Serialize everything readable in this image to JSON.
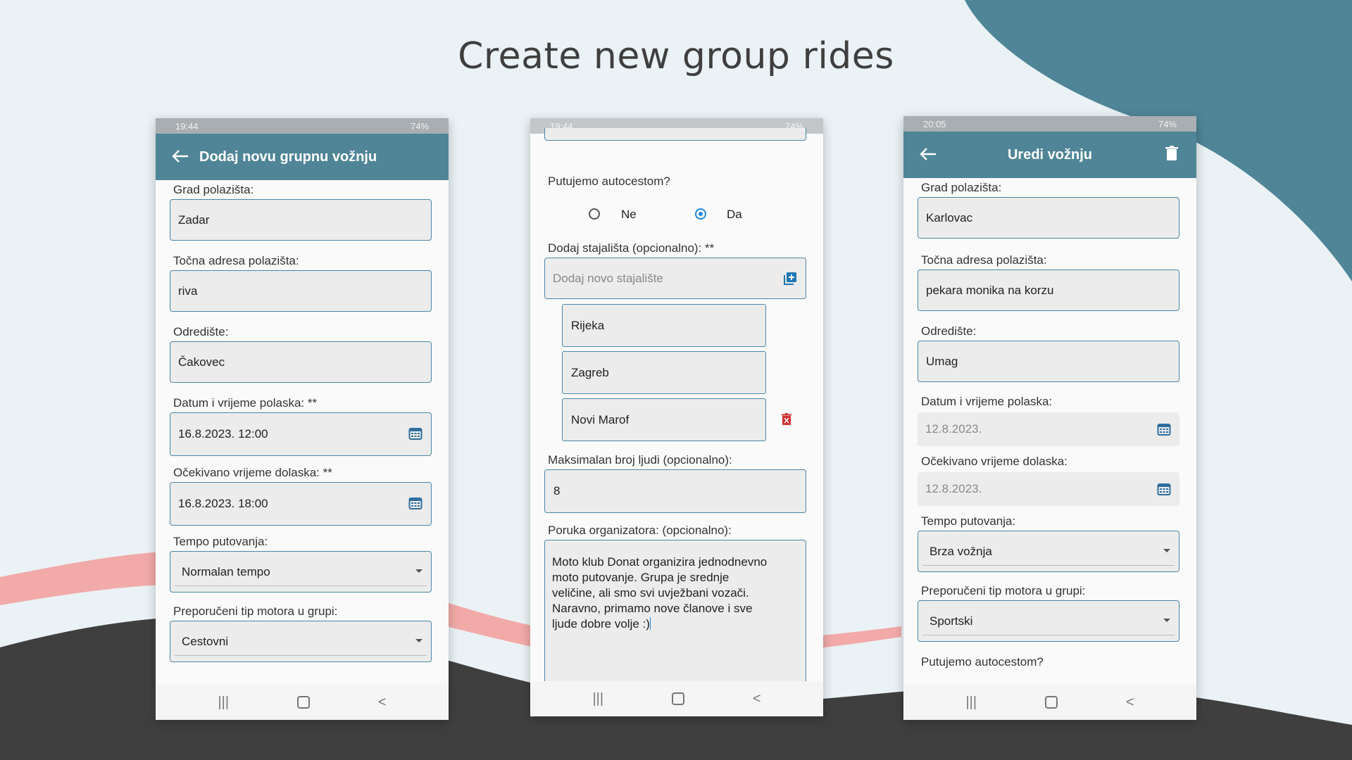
{
  "headline": "Create new group rides",
  "colors": {
    "appbar": "#4f8597",
    "field_border": "#4a86a8",
    "accent_blue": "#1e88e5",
    "delete_red": "#d32f2f",
    "blob_teal": "#4f8597",
    "blob_pink": "#f2aaa8",
    "blob_dark": "#3f3f3f"
  },
  "phone1": {
    "status": {
      "time": "19:44",
      "battery": "74%"
    },
    "appbar_title": "Dodaj novu grupnu vožnju",
    "icons": {
      "back": "arrow-left-icon",
      "calendar": "calendar-icon"
    },
    "fields": {
      "grad_label": "Grad polazišta:",
      "grad_value": "Zadar",
      "adresa_label": "Točna adresa polazišta:",
      "adresa_value": "riva",
      "odrediste_label": "Odredište:",
      "odrediste_value": "Čakovec",
      "datum_label": "Datum i vrijeme polaska: **",
      "datum_value": "16.8.2023. 12:00",
      "dolazak_label": "Očekivano vrijeme dolaska: **",
      "dolazak_value": "16.8.2023. 18:00",
      "tempo_label": "Tempo putovanja:",
      "tempo_value": "Normalan tempo",
      "motor_label": "Preporučeni tip motora u grupi:",
      "motor_value": "Cestovni"
    }
  },
  "phone2": {
    "status": {
      "time": "19:44",
      "battery": "74%"
    },
    "autocesta_label": "Putujemo autocestom?",
    "radio_ne": "Ne",
    "radio_da": "Da",
    "radio_selected": "Da",
    "stajalista_label": "Dodaj stajališta (opcionalno): **",
    "stajalista_placeholder": "Dodaj novo stajalište",
    "stops": [
      "Rijeka",
      "Zagreb",
      "Novi Marof"
    ],
    "max_label": "Maksimalan broj ljudi (opcionalno):",
    "max_value": "8",
    "poruka_label": "Poruka organizatora: (opcionalno):",
    "poruka_lines": [
      "Moto klub Donat organizira jednodnevno",
      "moto putovanje. Grupa je srednje",
      "veličine, ali smo svi uvježbani vozači.",
      "Naravno, primamo nove članove i sve",
      "ljude dobre volje :)"
    ]
  },
  "phone3": {
    "status": {
      "time": "20:05",
      "battery": "74%"
    },
    "appbar_title": "Uredi vožnju",
    "icons": {
      "back": "arrow-left-icon",
      "delete": "trash-icon",
      "calendar": "calendar-icon"
    },
    "fields": {
      "grad_label": "Grad polazišta:",
      "grad_value": "Karlovac",
      "adresa_label": "Točna adresa polazišta:",
      "adresa_value": "pekara monika na korzu",
      "odrediste_label": "Odredište:",
      "odrediste_value": "Umag",
      "datum_label": "Datum i vrijeme polaska:",
      "datum_value": "12.8.2023.",
      "dolazak_label": "Očekivano vrijeme dolaska:",
      "dolazak_value": "12.8.2023.",
      "tempo_label": "Tempo putovanja:",
      "tempo_value": "Brza vožnja",
      "motor_label": "Preporučeni tip motora u grupi:",
      "motor_value": "Sportski",
      "autocesta_label": "Putujemo autocestom?"
    }
  }
}
